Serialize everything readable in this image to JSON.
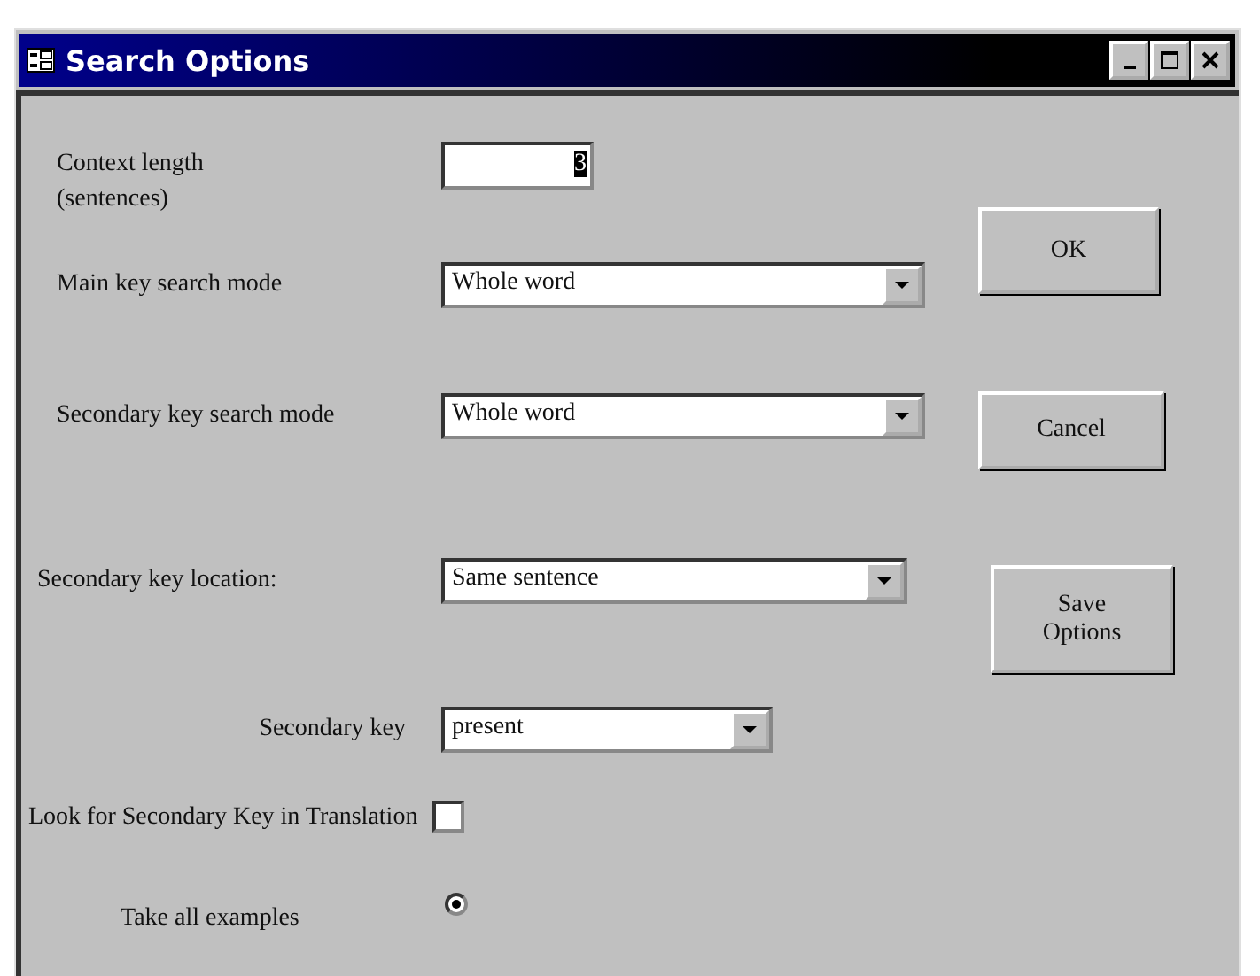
{
  "window": {
    "title": "Search Options"
  },
  "fields": [
    {
      "kind": "input",
      "label": "Context length (sentences)",
      "value": "3"
    },
    {
      "kind": "select",
      "label": "Main key search mode",
      "value": "Whole word"
    },
    {
      "kind": "select",
      "label": "Secondary key search mode",
      "value": "Whole word"
    },
    {
      "kind": "select",
      "label": "Secondary key location:",
      "value": "Same sentence"
    },
    {
      "kind": "select",
      "label": "Secondary key",
      "value": "present"
    },
    {
      "kind": "checkbox",
      "label": "Look for Secondary Key in Translation",
      "checked": false
    },
    {
      "kind": "radio",
      "label": "Take all examples",
      "selected": true
    }
  ],
  "buttons": [
    "OK",
    "Cancel",
    "Save Options"
  ]
}
